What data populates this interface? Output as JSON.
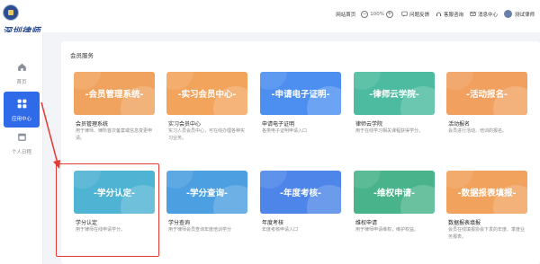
{
  "header": {
    "logo_text": "深圳律师",
    "links": [
      "网站首页",
      "问题反馈",
      "客服咨询",
      "消息中心"
    ],
    "zoom_value": "100%",
    "user_name": "测试律师"
  },
  "sidebar": {
    "items": [
      {
        "label": "首页",
        "icon": "home-icon"
      },
      {
        "label": "应用中心",
        "icon": "apps-icon",
        "active": true
      },
      {
        "label": "个人日程",
        "icon": "calendar-icon"
      }
    ]
  },
  "main": {
    "section_title": "会员服务",
    "cards": [
      {
        "banner": "-会员管理系统-",
        "name": "会员管理系统",
        "desc": "用于律师、律所首次备案或信息变更申请。",
        "color": "#f0a35e"
      },
      {
        "banner": "-实习会员中心-",
        "name": "实习会员中心",
        "desc": "实习人员会员中心，可在线办理各种实习业务。",
        "color": "#f3a45c"
      },
      {
        "banner": "-申请电子证明-",
        "name": "申请电子证明",
        "desc": "各类电子证明申请入口",
        "color": "#4c8ff0"
      },
      {
        "banner": "-律师云学院-",
        "name": "律师云学院",
        "desc": "用于在线学习相关课程获得学分。",
        "color": "#4cbba0"
      },
      {
        "banner": "-活动报名-",
        "name": "活动报名",
        "desc": "会员进行活动、培训的报名。",
        "color": "#f1a05f"
      },
      {
        "banner": "-学分认定-",
        "name": "学分认定",
        "desc": "用于律师在线申请学分。",
        "color": "#4fb3d3"
      },
      {
        "banner": "-学分查询-",
        "name": "学分查询",
        "desc": "用于律师会员查询年度培训学分",
        "color": "#4c9fe0"
      },
      {
        "banner": "-年度考核-",
        "name": "年度考核",
        "desc": "年度考核申请入口",
        "color": "#4d86e8"
      },
      {
        "banner": "-维权申请-",
        "name": "维权申请",
        "desc": "用于律师申请维权，维护权益。",
        "color": "#49b48c"
      },
      {
        "banner": "-数据报表填报-",
        "name": "数据报表填报",
        "desc": "会员在线填报协会下发的年度、季度业务报表。",
        "color": "#f1a25c"
      }
    ]
  },
  "colors": {
    "accent": "#2f6be8",
    "highlight": "#e53935"
  }
}
